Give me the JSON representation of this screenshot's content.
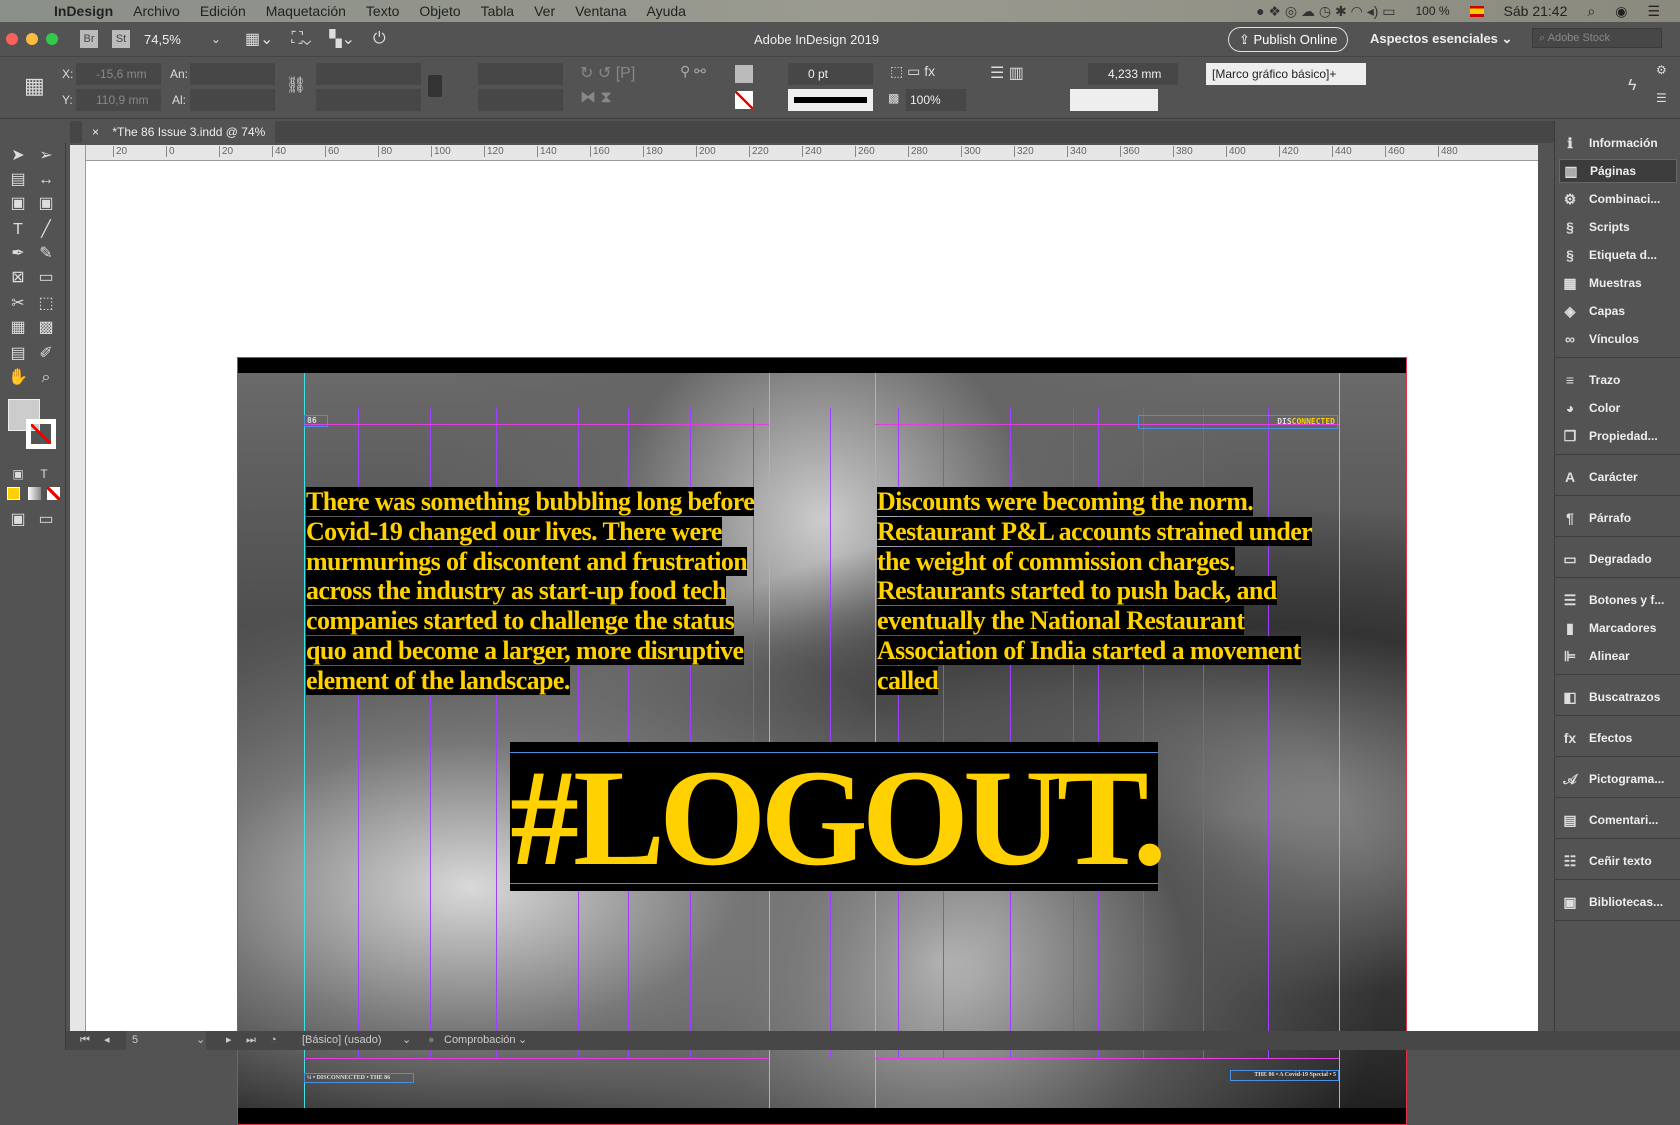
{
  "menubar": {
    "app": "InDesign",
    "items": [
      "Archivo",
      "Edición",
      "Maquetación",
      "Texto",
      "Objeto",
      "Tabla",
      "Ver",
      "Ventana",
      "Ayuda"
    ],
    "battery": "100 %",
    "clock": "Sáb 21:42"
  },
  "titlebar": {
    "br": "Br",
    "st": "St",
    "zoom": "74,5%",
    "title": "Adobe InDesign 2019",
    "publish": "Publish Online",
    "workspace": "Aspectos esenciales",
    "stock_placeholder": "Adobe Stock"
  },
  "control": {
    "x_label": "X:",
    "x": "-15,6 mm",
    "y_label": "Y:",
    "y": "110,9 mm",
    "w_label": "An:",
    "h_label": "Al:",
    "stroke": "0 pt",
    "opacity": "100%",
    "offset": "4,233 mm",
    "style": "[Marco gráfico básico]+"
  },
  "tab": {
    "close": "×",
    "label": "*The 86 Issue 3.indd @ 74%"
  },
  "ruler": [
    "20",
    "0",
    "20",
    "40",
    "60",
    "80",
    "100",
    "120",
    "140",
    "160",
    "180",
    "200",
    "220",
    "240",
    "260",
    "280",
    "300",
    "320",
    "340",
    "360",
    "380",
    "400",
    "420",
    "440",
    "460",
    "480"
  ],
  "page": {
    "folio": "86",
    "header_right_a": "DIS",
    "header_right_b": "CONNECTED",
    "left_text": "There was something bubbling long before Covid-19 changed our lives.  There were murmurings of discontent and frustration across the industry as start-up food tech companies started to challenge the status quo and become a larger, more disruptive element of the landscape.",
    "right_text": "Discounts were becoming the norm. Restaurant P&L accounts strained under the weight of commission charges. Restaurants started to push back, and eventually the National Restaurant Association of India started a movement called",
    "headline": "#LOGOUT.",
    "footer_left": "¼ • DISCONNECTED • THE 86",
    "footer_right": "THE 86 • A Covid-19 Special • 5"
  },
  "panels": [
    {
      "icon": "info-icon",
      "glyph": "ℹ",
      "label": "Información"
    },
    {
      "icon": "pages-icon",
      "glyph": "▥",
      "label": "Páginas"
    },
    {
      "icon": "data-merge-icon",
      "glyph": "⚙",
      "label": "Combinaci..."
    },
    {
      "icon": "scripts-icon",
      "glyph": "§",
      "label": "Scripts"
    },
    {
      "icon": "script-label-icon",
      "glyph": "§",
      "label": "Etiqueta d..."
    },
    {
      "icon": "swatches-icon",
      "glyph": "▦",
      "label": "Muestras"
    },
    {
      "icon": "layers-icon",
      "glyph": "◈",
      "label": "Capas"
    },
    {
      "icon": "links-icon",
      "glyph": "∞",
      "label": "Vínculos"
    },
    {
      "icon": "stroke-icon",
      "glyph": "≡",
      "label": "Trazo"
    },
    {
      "icon": "color-icon",
      "glyph": "◕",
      "label": "Color"
    },
    {
      "icon": "properties-icon",
      "glyph": "❐",
      "label": "Propiedad..."
    },
    {
      "icon": "character-icon",
      "glyph": "A",
      "label": "Carácter"
    },
    {
      "icon": "paragraph-icon",
      "glyph": "¶",
      "label": "Párrafo"
    },
    {
      "icon": "gradient-icon",
      "glyph": "▭",
      "label": "Degradado"
    },
    {
      "icon": "buttons-icon",
      "glyph": "☰",
      "label": "Botones y f..."
    },
    {
      "icon": "bookmarks-icon",
      "glyph": "▮",
      "label": "Marcadores"
    },
    {
      "icon": "align-icon",
      "glyph": "⊫",
      "label": "Alinear"
    },
    {
      "icon": "pathfinder-icon",
      "glyph": "◧",
      "label": "Buscatrazos"
    },
    {
      "icon": "effects-icon",
      "glyph": "fx",
      "label": "Efectos"
    },
    {
      "icon": "glyphs-icon",
      "glyph": "𝒜",
      "label": "Pictograma..."
    },
    {
      "icon": "comments-icon",
      "glyph": "▤",
      "label": "Comentari..."
    },
    {
      "icon": "text-wrap-icon",
      "glyph": "☷",
      "label": "Ceñir texto"
    },
    {
      "icon": "libraries-icon",
      "glyph": "▣",
      "label": "Bibliotecas..."
    }
  ],
  "status": {
    "page": "5",
    "master": "[Básico] (usado)",
    "preflight": "Comprobación"
  },
  "colors": {
    "accent": "#ffd100",
    "bleed": "#e2304a",
    "guide": "#a040ff"
  }
}
